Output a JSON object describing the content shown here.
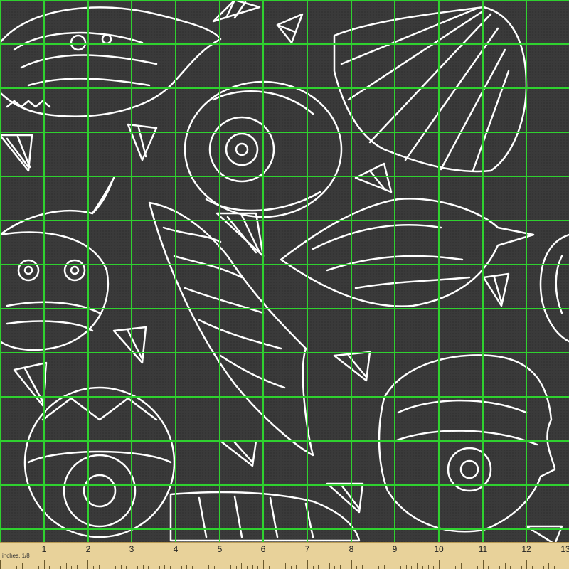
{
  "image": {
    "description_type": "fabric swatch product photo",
    "motif": "seashell",
    "colors": {
      "background": "#3a3a3a",
      "line_art": "#ffffff",
      "grid": "#2fd12f",
      "ruler": "#e8d29a",
      "ruler_text": "#222222"
    }
  },
  "ruler": {
    "unit_label": "inches, 1/8",
    "numbers": [
      "1",
      "2",
      "3",
      "4",
      "5",
      "6",
      "7",
      "8",
      "9",
      "10",
      "11",
      "12",
      "13"
    ]
  }
}
